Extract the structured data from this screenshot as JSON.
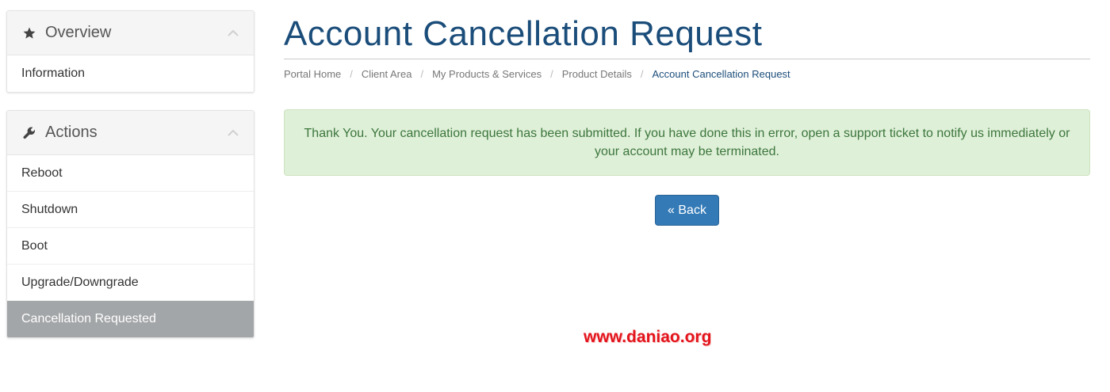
{
  "sidebar": {
    "overview": {
      "title": "Overview",
      "icon": "star-icon",
      "items": [
        {
          "label": "Information"
        }
      ]
    },
    "actions": {
      "title": "Actions",
      "icon": "wrench-icon",
      "items": [
        {
          "label": "Reboot"
        },
        {
          "label": "Shutdown"
        },
        {
          "label": "Boot"
        },
        {
          "label": "Upgrade/Downgrade"
        },
        {
          "label": "Cancellation Requested",
          "active": true
        }
      ]
    }
  },
  "main": {
    "title": "Account Cancellation Request",
    "breadcrumb": [
      "Portal Home",
      "Client Area",
      "My Products & Services",
      "Product Details",
      "Account Cancellation Request"
    ],
    "breadcrumb_separator": "/",
    "alert": {
      "text": "Thank You. Your cancellation request has been submitted. If you have done this in error, open a support ticket to notify us immediately or your account may be terminated."
    },
    "back_button": "« Back"
  },
  "watermark": "www.daniao.org",
  "colors": {
    "title": "#1b4d7a",
    "alert_bg": "#dff0d8",
    "alert_text": "#3c763d",
    "button_bg": "#337ab7",
    "active_item_bg": "#a3a6a8",
    "watermark": "#e3141c"
  }
}
